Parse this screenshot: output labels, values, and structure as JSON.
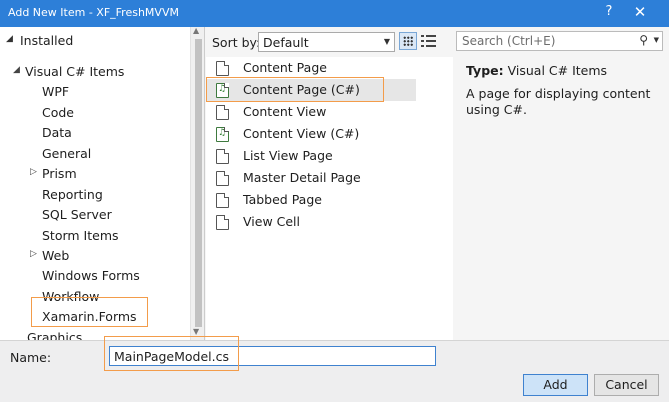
{
  "window": {
    "title": "Add New Item - XF_FreshMVVM",
    "help_glyph": "?",
    "close_glyph": "✕"
  },
  "tree": {
    "installed_label": "Installed",
    "root_label": "Visual C# Items",
    "items": [
      {
        "label": "WPF"
      },
      {
        "label": "Code"
      },
      {
        "label": "Data"
      },
      {
        "label": "General"
      },
      {
        "label": "Prism",
        "expandable": true
      },
      {
        "label": "Reporting"
      },
      {
        "label": "SQL Server"
      },
      {
        "label": "Storm Items"
      },
      {
        "label": "Web",
        "expandable": true
      },
      {
        "label": "Windows Forms"
      },
      {
        "label": "Workflow"
      },
      {
        "label": "Xamarin.Forms"
      },
      {
        "label": "Graphics"
      }
    ]
  },
  "toolbar": {
    "sort_label": "Sort by:",
    "sort_value": "Default"
  },
  "templates": [
    {
      "label": "Content Page",
      "icon": "page-icon"
    },
    {
      "label": "Content Page (C#)",
      "icon": "csharp-page-icon"
    },
    {
      "label": "Content View",
      "icon": "page-icon"
    },
    {
      "label": "Content View (C#)",
      "icon": "csharp-page-icon"
    },
    {
      "label": "List View Page",
      "icon": "page-icon"
    },
    {
      "label": "Master Detail Page",
      "icon": "page-icon"
    },
    {
      "label": "Tabbed Page",
      "icon": "page-icon"
    },
    {
      "label": "View Cell",
      "icon": "page-icon"
    }
  ],
  "details": {
    "search_placeholder": "Search (Ctrl+E)",
    "type_label": "Type:",
    "type_value": "Visual C# Items",
    "description": "A page for displaying content using C#."
  },
  "form": {
    "name_label": "Name:",
    "name_value": "MainPageModel.cs"
  },
  "buttons": {
    "add": "Add",
    "cancel": "Cancel"
  },
  "colors": {
    "titlebar": "#2d7fd8",
    "highlight": "#f39c4a",
    "accent": "#3f82cf"
  }
}
